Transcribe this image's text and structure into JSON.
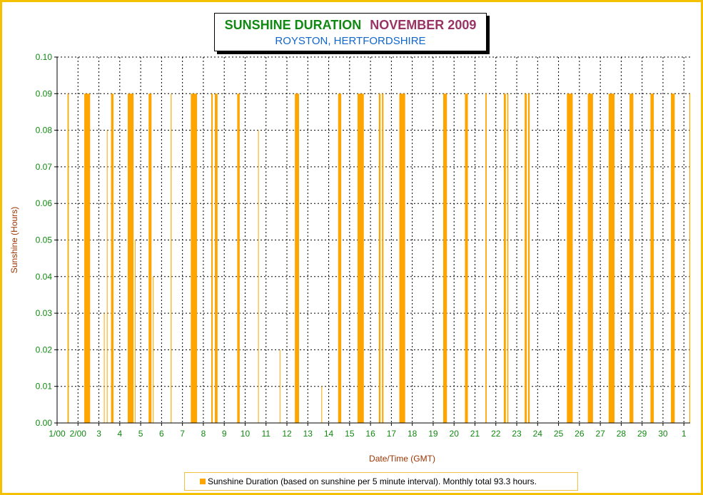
{
  "title": {
    "main": "SUNSHINE DURATION",
    "month": "NOVEMBER 2009",
    "location": "ROYSTON, HERTFORDSHIRE"
  },
  "legend": {
    "label": "Sunshine Duration (based on sunshine per 5 minute interval). Monthly total 93.3 hours."
  },
  "colors": {
    "bar": "#ffa500",
    "frame": "#f5c000",
    "tick_label": "#118811",
    "axis_title": "#993300"
  },
  "chart_data": {
    "type": "bar",
    "title": "SUNSHINE DURATION  NOVEMBER 2009",
    "subtitle": "ROYSTON, HERTFORDSHIRE",
    "xlabel": "Date/Time (GMT)",
    "ylabel": "Sunshine (Hours)",
    "ylim": [
      0,
      0.1
    ],
    "xlim": [
      1,
      31.3
    ],
    "x_unit": "day of November 2009",
    "yticks": [
      "0.00",
      "0.01",
      "0.02",
      "0.03",
      "0.04",
      "0.05",
      "0.06",
      "0.07",
      "0.08",
      "0.09",
      "0.10"
    ],
    "xticks": [
      {
        "day": 1,
        "label": "1/00"
      },
      {
        "day": 2,
        "label": "2/00"
      },
      {
        "day": 3,
        "label": "3"
      },
      {
        "day": 4,
        "label": "4"
      },
      {
        "day": 5,
        "label": "5"
      },
      {
        "day": 6,
        "label": "6"
      },
      {
        "day": 7,
        "label": "7"
      },
      {
        "day": 8,
        "label": "8"
      },
      {
        "day": 9,
        "label": "9"
      },
      {
        "day": 10,
        "label": "10"
      },
      {
        "day": 11,
        "label": "11"
      },
      {
        "day": 12,
        "label": "12"
      },
      {
        "day": 13,
        "label": "13"
      },
      {
        "day": 14,
        "label": "14"
      },
      {
        "day": 15,
        "label": "15"
      },
      {
        "day": 16,
        "label": "16"
      },
      {
        "day": 17,
        "label": "17"
      },
      {
        "day": 18,
        "label": "18"
      },
      {
        "day": 19,
        "label": "19"
      },
      {
        "day": 20,
        "label": "20"
      },
      {
        "day": 21,
        "label": "21"
      },
      {
        "day": 22,
        "label": "22"
      },
      {
        "day": 23,
        "label": "23"
      },
      {
        "day": 24,
        "label": "24"
      },
      {
        "day": 25,
        "label": "25"
      },
      {
        "day": 26,
        "label": "26"
      },
      {
        "day": 27,
        "label": "27"
      },
      {
        "day": 28,
        "label": "28"
      },
      {
        "day": 29,
        "label": "29"
      },
      {
        "day": 30,
        "label": "30"
      },
      {
        "day": 31,
        "label": "1"
      }
    ],
    "grid": true,
    "legend_position": "bottom",
    "series": [
      {
        "name": "Sunshine Duration (based on sunshine per 5 minute interval). Monthly total 93.3 hours.",
        "color": "#ffa500",
        "periods": [
          {
            "start": 1.5,
            "end": 1.56,
            "value": 0.09
          },
          {
            "start": 2.3,
            "end": 2.58,
            "value": 0.09
          },
          {
            "start": 3.24,
            "end": 3.26,
            "value": 0.03
          },
          {
            "start": 3.38,
            "end": 3.4,
            "value": 0.08
          },
          {
            "start": 3.58,
            "end": 3.7,
            "value": 0.09
          },
          {
            "start": 4.38,
            "end": 4.66,
            "value": 0.09
          },
          {
            "start": 4.72,
            "end": 4.74,
            "value": 0.05
          },
          {
            "start": 5.38,
            "end": 5.52,
            "value": 0.09
          },
          {
            "start": 5.58,
            "end": 5.6,
            "value": 0.04
          },
          {
            "start": 6.44,
            "end": 6.48,
            "value": 0.09
          },
          {
            "start": 7.4,
            "end": 7.7,
            "value": 0.09
          },
          {
            "start": 8.38,
            "end": 8.45,
            "value": 0.09
          },
          {
            "start": 8.55,
            "end": 8.68,
            "value": 0.09
          },
          {
            "start": 9.62,
            "end": 9.74,
            "value": 0.09
          },
          {
            "start": 10.62,
            "end": 10.64,
            "value": 0.08
          },
          {
            "start": 11.65,
            "end": 11.67,
            "value": 0.02
          },
          {
            "start": 12.38,
            "end": 12.58,
            "value": 0.09
          },
          {
            "start": 13.65,
            "end": 13.67,
            "value": 0.01
          },
          {
            "start": 14.45,
            "end": 14.6,
            "value": 0.09
          },
          {
            "start": 15.38,
            "end": 15.68,
            "value": 0.09
          },
          {
            "start": 16.4,
            "end": 16.48,
            "value": 0.09
          },
          {
            "start": 16.55,
            "end": 16.62,
            "value": 0.09
          },
          {
            "start": 17.38,
            "end": 17.66,
            "value": 0.09
          },
          {
            "start": 19.48,
            "end": 19.66,
            "value": 0.09
          },
          {
            "start": 20.52,
            "end": 20.66,
            "value": 0.09
          },
          {
            "start": 21.5,
            "end": 21.56,
            "value": 0.09
          },
          {
            "start": 22.38,
            "end": 22.48,
            "value": 0.09
          },
          {
            "start": 22.55,
            "end": 22.6,
            "value": 0.09
          },
          {
            "start": 23.38,
            "end": 23.48,
            "value": 0.09
          },
          {
            "start": 23.54,
            "end": 23.62,
            "value": 0.09
          },
          {
            "start": 25.4,
            "end": 25.68,
            "value": 0.09
          },
          {
            "start": 26.4,
            "end": 26.65,
            "value": 0.09
          },
          {
            "start": 27.4,
            "end": 27.68,
            "value": 0.09
          },
          {
            "start": 28.4,
            "end": 28.58,
            "value": 0.09
          },
          {
            "start": 29.4,
            "end": 29.56,
            "value": 0.09
          },
          {
            "start": 30.38,
            "end": 30.56,
            "value": 0.09
          },
          {
            "start": 31.26,
            "end": 31.3,
            "value": 0.09
          }
        ]
      }
    ]
  }
}
